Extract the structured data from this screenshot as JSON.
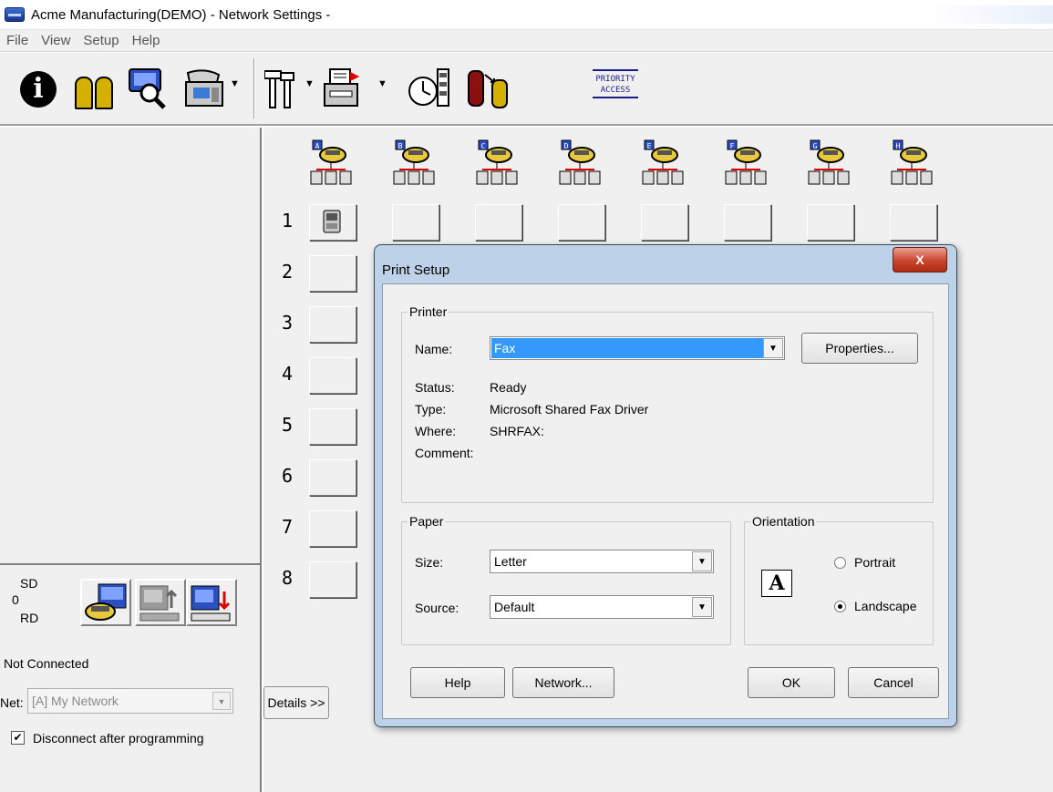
{
  "window": {
    "title": "Acme Manufacturing(DEMO) - Network Settings -"
  },
  "menu": [
    "File",
    "View",
    "Setup",
    "Help"
  ],
  "toolbar": {
    "priority_label": "PRIORITY ACCESS"
  },
  "left": {
    "sd_label": "SD",
    "zero_label": "0",
    "rd_label": "RD",
    "status": "Not Connected",
    "net_label": "Net:",
    "net_value": "[A] My Network",
    "disconnect_label": "Disconnect after programming",
    "disconnect_checked": true
  },
  "grid": {
    "columns": [
      "A",
      "B",
      "C",
      "D",
      "E",
      "F",
      "G",
      "H"
    ],
    "rows": [
      "1",
      "2",
      "3",
      "4",
      "5",
      "6",
      "7",
      "8"
    ],
    "details_label": "Details >>"
  },
  "dialog": {
    "title": "Print Setup",
    "close_label": "X",
    "printer": {
      "group_label": "Printer",
      "name_label": "Name:",
      "name_value": "Fax",
      "properties_label": "Properties...",
      "status_label": "Status:",
      "status_value": "Ready",
      "type_label": "Type:",
      "type_value": "Microsoft Shared Fax Driver",
      "where_label": "Where:",
      "where_value": "SHRFAX:",
      "comment_label": "Comment:"
    },
    "paper": {
      "group_label": "Paper",
      "size_label": "Size:",
      "size_value": "Letter",
      "source_label": "Source:",
      "source_value": "Default"
    },
    "orientation": {
      "group_label": "Orientation",
      "portrait_label": "Portrait",
      "landscape_label": "Landscape",
      "selected": "Landscape"
    },
    "buttons": {
      "help": "Help",
      "network": "Network...",
      "ok": "OK",
      "cancel": "Cancel"
    }
  }
}
